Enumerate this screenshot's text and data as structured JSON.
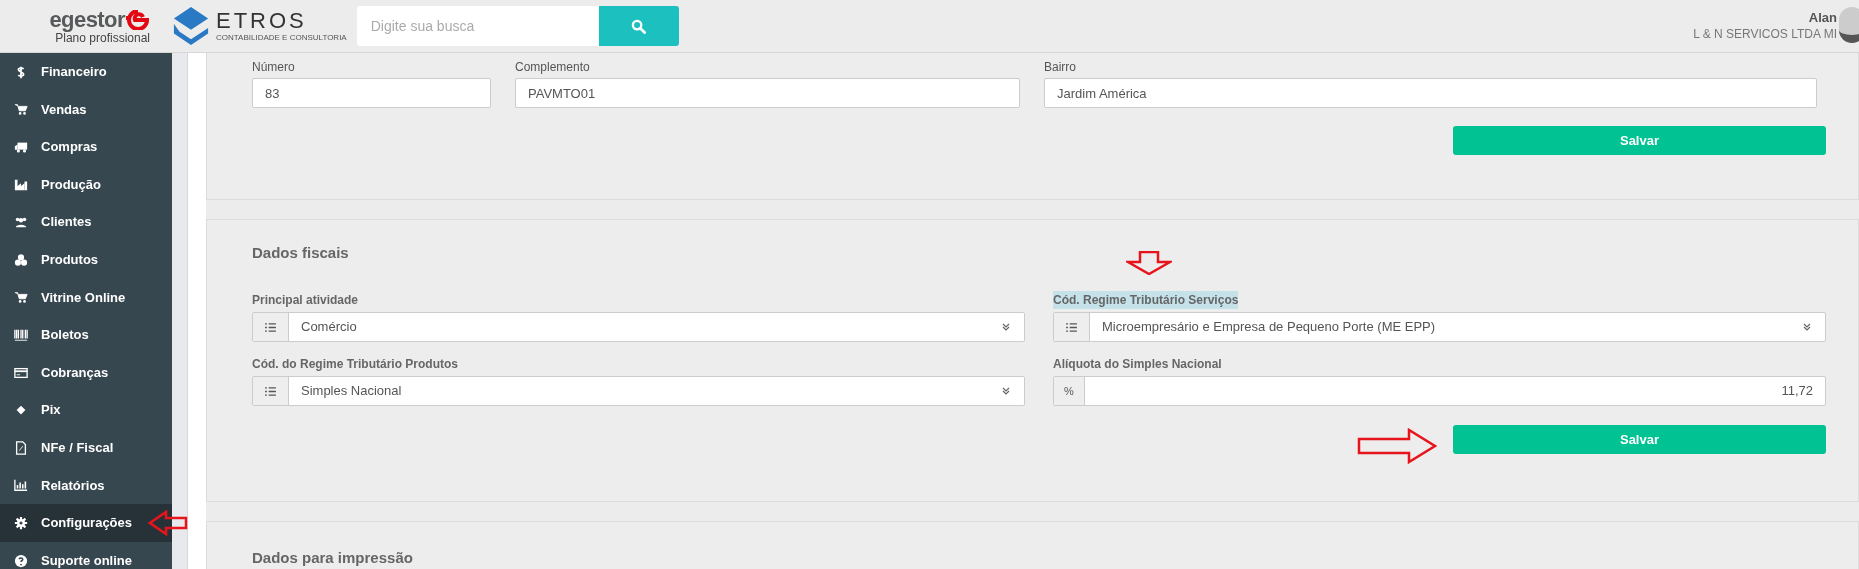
{
  "header": {
    "brand": "egestor",
    "plan": "Plano profissional",
    "partner_logo": "ETROS",
    "partner_tagline": "CONTABILIDADE E CONSULTORIA",
    "search": {
      "placeholder": "Digite sua busca"
    },
    "user": {
      "name": "Alan",
      "company": "L & N SERVICOS LTDA MI"
    }
  },
  "sidebar": {
    "items": [
      {
        "label": "Financeiro",
        "selected": false
      },
      {
        "label": "Vendas",
        "selected": false
      },
      {
        "label": "Compras",
        "selected": false
      },
      {
        "label": "Produção",
        "selected": false
      },
      {
        "label": "Clientes",
        "selected": false
      },
      {
        "label": "Produtos",
        "selected": false
      },
      {
        "label": "Vitrine Online",
        "selected": false
      },
      {
        "label": "Boletos",
        "selected": false
      },
      {
        "label": "Cobranças",
        "selected": false
      },
      {
        "label": "Pix",
        "selected": false
      },
      {
        "label": "NFe / Fiscal",
        "selected": false
      },
      {
        "label": "Relatórios",
        "selected": false
      },
      {
        "label": "Configurações",
        "selected": true
      },
      {
        "label": "Suporte online",
        "selected": false
      }
    ]
  },
  "address_card": {
    "fields": [
      {
        "label": "Número",
        "value": "83"
      },
      {
        "label": "Complemento",
        "value": "PAVMTO01"
      },
      {
        "label": "Bairro",
        "value": "Jardim América"
      }
    ],
    "save_button": "Salvar"
  },
  "fiscal_card": {
    "title": "Dados fiscais",
    "fields": [
      {
        "kind": "select",
        "label": "Principal atividade",
        "value": "Comércio",
        "highlighted": false
      },
      {
        "kind": "select",
        "label": "Cód. Regime Tributário Serviços",
        "value": "Microempresário e Empresa de Pequeno Porte (ME EPP)",
        "highlighted": true
      },
      {
        "kind": "select",
        "label": "Cód. do Regime Tributário Produtos",
        "value": "Simples Nacional",
        "highlighted": false
      },
      {
        "kind": "percent",
        "label": "Alíquota do Simples Nacional",
        "addon": "%",
        "value": "11,72",
        "highlighted": false
      }
    ],
    "save_button": "Salvar"
  },
  "print_card": {
    "title": "Dados para impressão"
  }
}
